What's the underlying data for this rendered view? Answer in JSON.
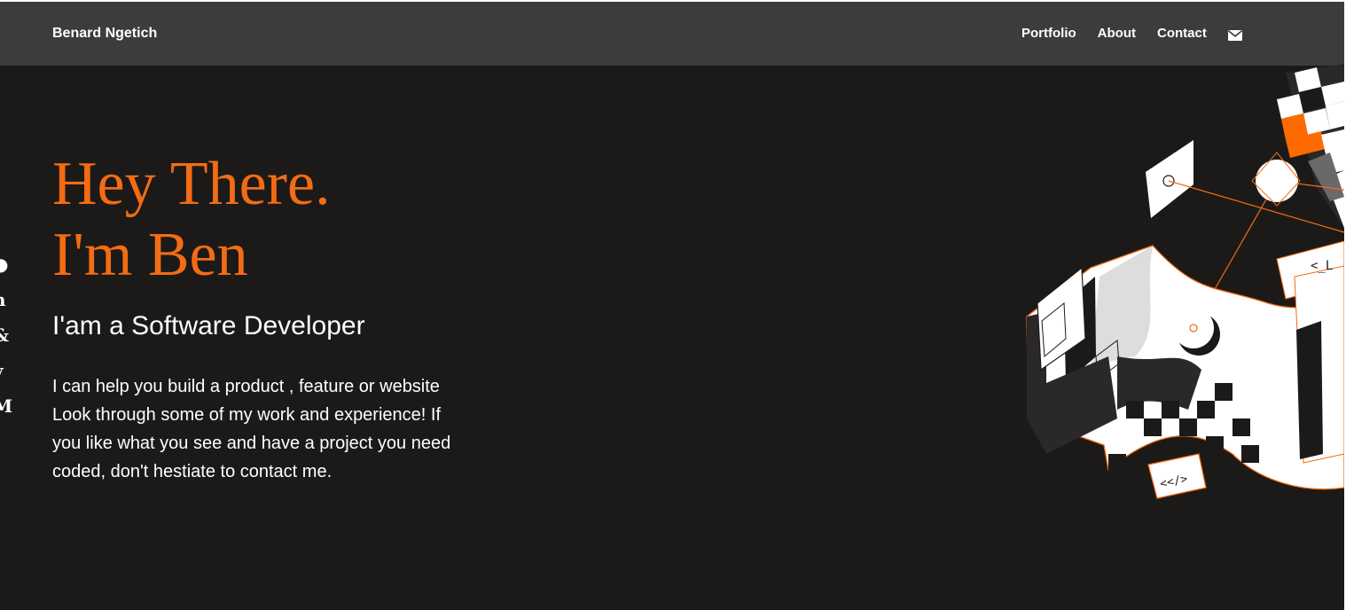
{
  "nav": {
    "brand": "Benard Ngetich",
    "links": [
      "Portfolio",
      "About",
      "Contact"
    ],
    "mail_icon": "envelope-icon"
  },
  "social_icons": [
    "github-icon",
    "linkedin-icon",
    "codepen-icon",
    "twitter-icon",
    "medium-icon"
  ],
  "hero": {
    "title_line1": "Hey There.",
    "title_line2": "I'm Ben",
    "subtitle": "I'am a Software Developer",
    "description": "I can help you build a product , feature or website Look through some of my work and experience! If you like what you see and have a project you need coded, don't hestiate to contact me."
  },
  "illustration": {
    "code_tag_top": "<_L",
    "code_tag_bottom": "<</>"
  },
  "colors": {
    "accent": "#f36c13",
    "background": "#1c1a19",
    "navbar": "#3d3b3c",
    "text": "#ffffff"
  }
}
